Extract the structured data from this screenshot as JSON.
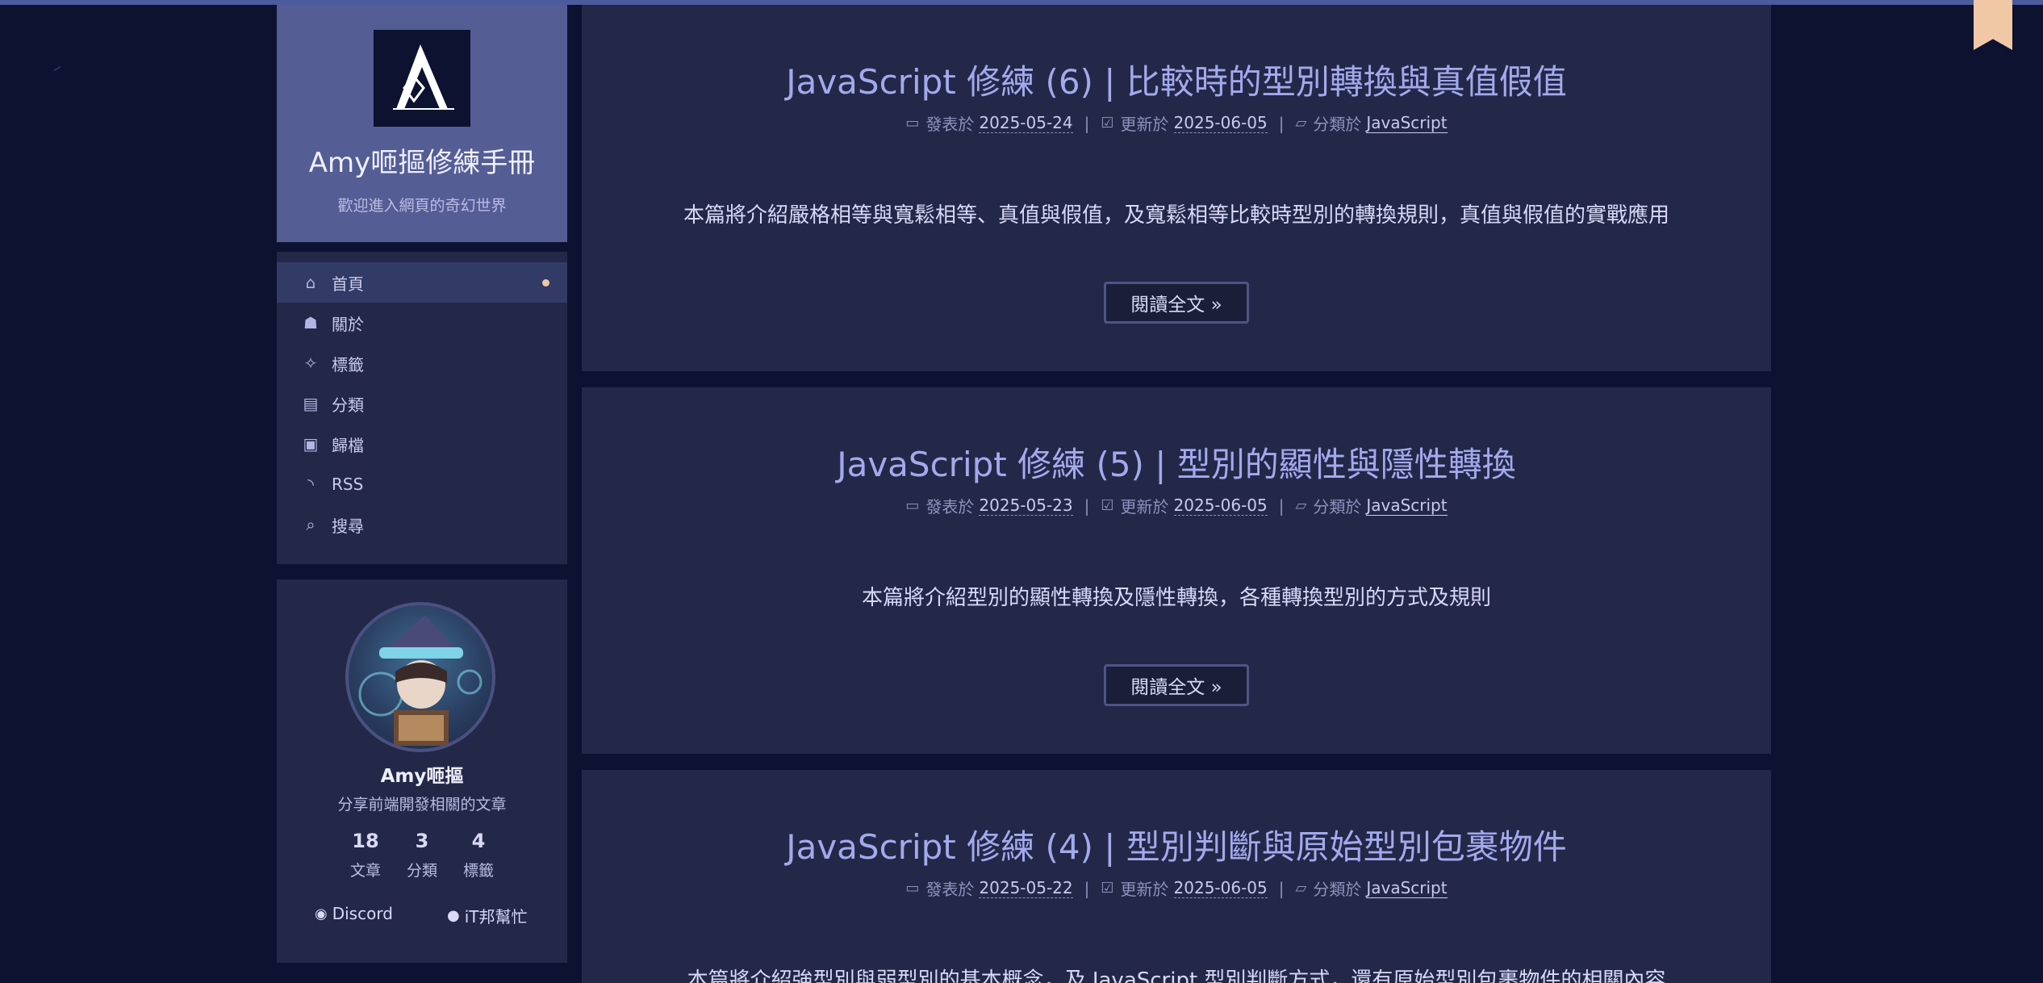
{
  "site": {
    "title": "Amy咂摳修練手冊",
    "subtitle": "歡迎進入網頁的奇幻世界"
  },
  "menu": {
    "items": [
      {
        "label": "首頁",
        "icon": "home-icon",
        "active": true
      },
      {
        "label": "關於",
        "icon": "user-icon"
      },
      {
        "label": "標籤",
        "icon": "magic-wand-icon"
      },
      {
        "label": "分類",
        "icon": "scroll-icon"
      },
      {
        "label": "歸檔",
        "icon": "archive-box-icon"
      },
      {
        "label": "RSS",
        "icon": "rss-icon"
      },
      {
        "label": "搜尋",
        "icon": "search-icon"
      }
    ]
  },
  "profile": {
    "name": "Amy咂摳",
    "description": "分享前端開發相關的文章",
    "stats": [
      {
        "count": "18",
        "label": "文章"
      },
      {
        "count": "3",
        "label": "分類"
      },
      {
        "count": "4",
        "label": "標籤"
      }
    ],
    "links": [
      {
        "label": "Discord",
        "icon": "discord-icon"
      },
      {
        "label": "iT邦幫忙",
        "icon": "comment-icon"
      }
    ]
  },
  "meta_labels": {
    "posted": "發表於",
    "updated": "更新於",
    "category": "分類於",
    "separator": "|"
  },
  "posts": [
    {
      "title": "JavaScript 修練 (6) | 比較時的型別轉換與真值假值",
      "posted": "2025-05-24",
      "updated": "2025-06-05",
      "category": "JavaScript",
      "excerpt": "本篇將介紹嚴格相等與寬鬆相等、真值與假值，及寬鬆相等比較時型別的轉換規則，真值與假值的實戰應用",
      "read_more": "閱讀全文 »"
    },
    {
      "title": "JavaScript 修練 (5) | 型別的顯性與隱性轉換",
      "posted": "2025-05-23",
      "updated": "2025-06-05",
      "category": "JavaScript",
      "excerpt": "本篇將介紹型別的顯性轉換及隱性轉換，各種轉換型別的方式及規則",
      "read_more": "閱讀全文 »"
    },
    {
      "title": "JavaScript 修練 (4) | 型別判斷與原始型別包裹物件",
      "posted": "2025-05-22",
      "updated": "2025-06-05",
      "category": "JavaScript",
      "excerpt": "本篇將介紹強型別與弱型別的基本概念，及 JavaScript 型別判斷方式，還有原始型別包裹物件的相關內容",
      "read_more": "閱讀全文 »"
    }
  ],
  "colors": {
    "background": "#0c1230",
    "panel": "#232848",
    "brand_header": "#555d95",
    "post_title": "#a3a9ec",
    "accent_dot": "#f0c8a6",
    "bookmark": "#f0c8a6"
  }
}
